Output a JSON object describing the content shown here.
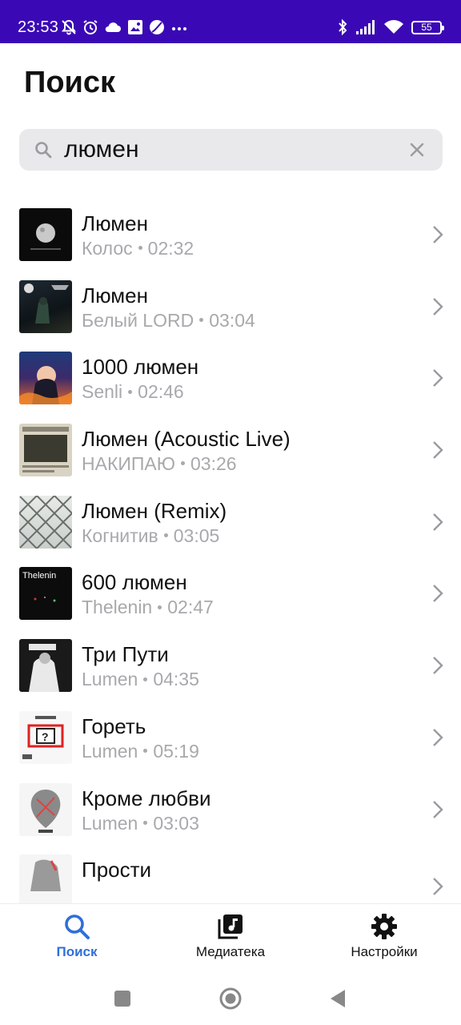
{
  "status_bar": {
    "time": "23:53",
    "left_icons": [
      "mute-bell-icon",
      "alarm-icon",
      "cloud-icon",
      "gallery-icon",
      "ball-icon",
      "more-dots-icon"
    ],
    "right_icons": [
      "bluetooth-icon",
      "signal-icon",
      "wifi-icon"
    ],
    "battery": "55"
  },
  "page": {
    "title": "Поиск"
  },
  "search": {
    "value": "люмен",
    "placeholder": "",
    "icon": "search-icon",
    "clear_icon": "close-icon"
  },
  "results": [
    {
      "title": "Люмен",
      "artist": "Колос",
      "duration": "02:32"
    },
    {
      "title": "Люмен",
      "artist": "Белый LORD",
      "duration": "03:04"
    },
    {
      "title": "1000 люмен",
      "artist": "Senli",
      "duration": "02:46"
    },
    {
      "title": "Люмен (Acoustic Live)",
      "artist": "НАКИПАЮ",
      "duration": "03:26"
    },
    {
      "title": "Люмен (Remix)",
      "artist": "Когнитив",
      "duration": "03:05"
    },
    {
      "title": "600 люмен",
      "artist": "Thelenin",
      "duration": "02:47"
    },
    {
      "title": "Три Пути",
      "artist": "Lumen",
      "duration": "04:35"
    },
    {
      "title": "Гореть",
      "artist": "Lumen",
      "duration": "05:19"
    },
    {
      "title": "Кроме любви",
      "artist": "Lumen",
      "duration": "03:03"
    },
    {
      "title": "Прости",
      "artist": "",
      "duration": ""
    }
  ],
  "cover_text": {
    "row6": "Thelenin"
  },
  "bottom_nav": {
    "search": "Поиск",
    "library": "Медиатека",
    "settings": "Настройки"
  },
  "colors": {
    "status_bar": "#3a09b5",
    "accent": "#2f6fd9",
    "secondary_text": "#a9a9ad",
    "search_bg": "#e9e9eb"
  }
}
